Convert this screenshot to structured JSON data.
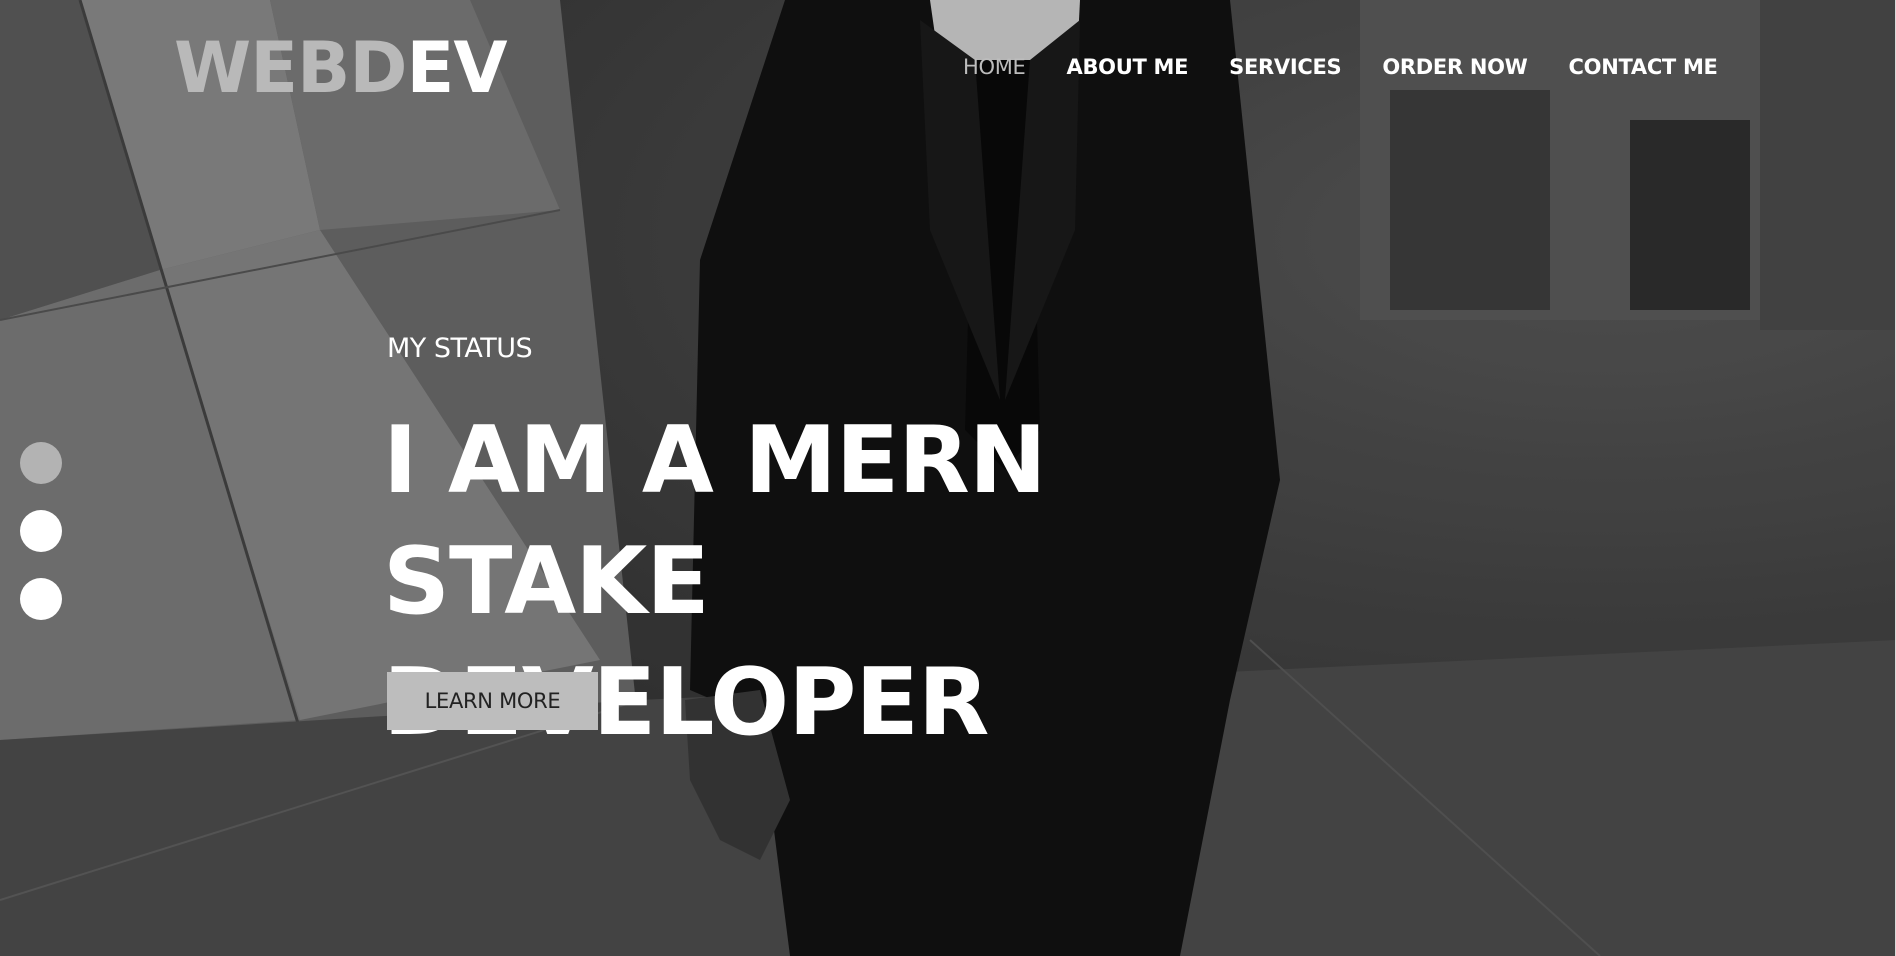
{
  "brand": {
    "logo_part1": "WEB",
    "logo_part2": "D",
    "logo_part3": "EV",
    "accent_color": "#b9b9b9"
  },
  "nav": {
    "items": [
      {
        "label": "HOME",
        "active": true
      },
      {
        "label": "ABOUT ME",
        "active": false
      },
      {
        "label": "SERVICES",
        "active": false
      },
      {
        "label": "ORDER NOW",
        "active": false
      },
      {
        "label": "CONTACT ME",
        "active": false
      }
    ]
  },
  "hero": {
    "status_label": "MY STATUS",
    "headline_line1": "I AM A MERN STAKE",
    "headline_line2": "DEVELOPER",
    "cta_label": "LEARN MORE"
  },
  "slider": {
    "dot_count": 3,
    "active_index": 0
  },
  "colors": {
    "text": "#ffffff",
    "button_bg": "#bdbdbd",
    "button_text": "#222222",
    "dot_active": "#b3b3b3",
    "dot_inactive": "#ffffff"
  }
}
